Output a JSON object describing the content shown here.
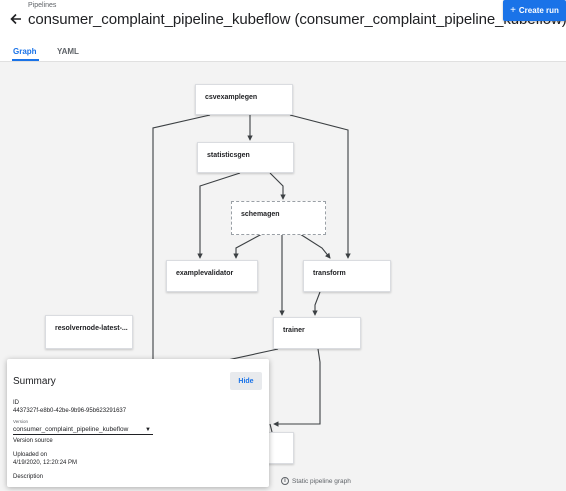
{
  "header": {
    "breadcrumb": "Pipelines",
    "title": "consumer_complaint_pipeline_kubeflow (consumer_complaint_pipeline_kubeflow)",
    "create_run_label": "Create run"
  },
  "tabs": [
    {
      "label": "Graph",
      "active": true
    },
    {
      "label": "YAML",
      "active": false
    }
  ],
  "graph": {
    "nodes": [
      {
        "id": "csvexamplegen",
        "label": "csvexamplegen"
      },
      {
        "id": "statisticsgen",
        "label": "statisticsgen"
      },
      {
        "id": "schemagen",
        "label": "schemagen"
      },
      {
        "id": "examplevalidator",
        "label": "examplevalidator"
      },
      {
        "id": "transform",
        "label": "transform"
      },
      {
        "id": "resolvernode",
        "label": "resolvernode-latest-..."
      },
      {
        "id": "trainer",
        "label": "trainer"
      }
    ],
    "static_note": "Static pipeline graph"
  },
  "summary": {
    "title": "Summary",
    "hide_label": "Hide",
    "id_label": "ID",
    "id_value": "4437327f-e8b0-42be-9b96-95b623291637",
    "version_label": "Version",
    "version_value": "consumer_complaint_pipeline_kubeflow",
    "version_source_label": "Version source",
    "uploaded_label": "Uploaded on",
    "uploaded_value": "4/19/2020, 12:20:24 PM",
    "description_label": "Description"
  },
  "colors": {
    "accent": "#1a73e8",
    "canvas_bg": "#f3f3f3",
    "edge": "#3c4043"
  }
}
